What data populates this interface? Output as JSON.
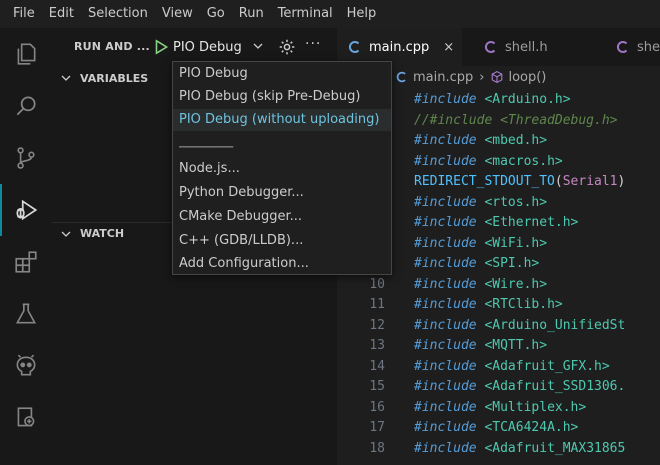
{
  "menubar": [
    "File",
    "Edit",
    "Selection",
    "View",
    "Go",
    "Run",
    "Terminal",
    "Help"
  ],
  "sidebar": {
    "title": "RUN AND ...",
    "config": "PIO Debug",
    "more": "···",
    "variables": "VARIABLES",
    "watch": "WATCH"
  },
  "dropdown": {
    "items": [
      "PIO Debug",
      "PIO Debug (skip Pre-Debug)",
      "PIO Debug (without uploading)"
    ],
    "separator": "──────────",
    "extra": [
      "Node.js...",
      "Python Debugger...",
      "CMake Debugger...",
      "C++ (GDB/LLDB)...",
      "Add Configuration..."
    ]
  },
  "tabs": [
    {
      "label": "main.cpp",
      "close": "×"
    },
    {
      "label": "shell.h"
    },
    {
      "label": "shel"
    }
  ],
  "breadcrumb": {
    "file": "main.cpp",
    "symbol": "loop()"
  },
  "code": [
    {
      "n": "",
      "kw": "#include",
      "text": " <Arduino.h>",
      "type": "inc"
    },
    {
      "n": "",
      "kw": "",
      "text": "//#include <ThreadDebug.h>",
      "type": "cm"
    },
    {
      "n": "",
      "kw": "#include",
      "text": " <mbed.h>",
      "type": "inc"
    },
    {
      "n": "",
      "kw": "#include",
      "text": " <macros.h>",
      "type": "inc"
    },
    {
      "n": "",
      "kw": "",
      "text": "REDIRECT_STDOUT_TO",
      "arg": "Serial1",
      "type": "mac"
    },
    {
      "n": "",
      "kw": "#include",
      "text": " <rtos.h>",
      "type": "inc"
    },
    {
      "n": "",
      "kw": "#include",
      "text": " <Ethernet.h>",
      "type": "inc"
    },
    {
      "n": "",
      "kw": "#include",
      "text": " <WiFi.h>",
      "type": "inc"
    },
    {
      "n": "",
      "kw": "#include",
      "text": " <SPI.h>",
      "type": "inc"
    },
    {
      "n": "10",
      "kw": "#include",
      "text": " <Wire.h>",
      "type": "inc"
    },
    {
      "n": "11",
      "kw": "#include",
      "text": " <RTClib.h>",
      "type": "inc"
    },
    {
      "n": "12",
      "kw": "#include",
      "text": " <Arduino_UnifiedSt",
      "type": "inc"
    },
    {
      "n": "13",
      "kw": "#include",
      "text": " <MQTT.h>",
      "type": "inc"
    },
    {
      "n": "14",
      "kw": "#include",
      "text": " <Adafruit_GFX.h>",
      "type": "inc"
    },
    {
      "n": "15",
      "kw": "#include",
      "text": " <Adafruit_SSD1306.",
      "type": "inc"
    },
    {
      "n": "16",
      "kw": "#include",
      "text": " <Multiplex.h>",
      "type": "inc"
    },
    {
      "n": "17",
      "kw": "#include",
      "text": " <TCA6424A.h>",
      "type": "inc"
    },
    {
      "n": "18",
      "kw": "#include",
      "text": " <Adafruit_MAX31865",
      "type": "inc"
    }
  ]
}
